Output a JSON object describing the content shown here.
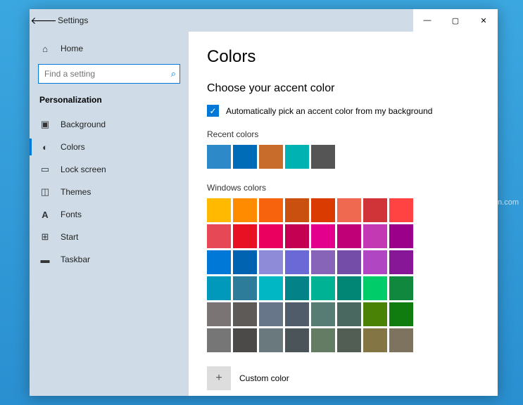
{
  "window": {
    "title": "Settings"
  },
  "sidebar": {
    "home": "Home",
    "search_placeholder": "Find a setting",
    "section": "Personalization",
    "items": [
      {
        "icon": "picture-icon",
        "label": "Background"
      },
      {
        "icon": "palette-icon",
        "label": "Colors"
      },
      {
        "icon": "lock-icon",
        "label": "Lock screen"
      },
      {
        "icon": "themes-icon",
        "label": "Themes"
      },
      {
        "icon": "fonts-icon",
        "label": "Fonts"
      },
      {
        "icon": "start-icon",
        "label": "Start"
      },
      {
        "icon": "taskbar-icon",
        "label": "Taskbar"
      }
    ]
  },
  "content": {
    "title": "Colors",
    "choose_heading": "Choose your accent color",
    "auto_checkbox_label": "Automatically pick an accent color from my background",
    "recent_heading": "Recent colors",
    "recent_colors": [
      "#2d89c8",
      "#006cb8",
      "#c86c2c",
      "#00b2b2",
      "#555555"
    ],
    "windows_heading": "Windows colors",
    "windows_colors": [
      "#ffb900",
      "#ff8c00",
      "#f7630c",
      "#ca5010",
      "#da3b01",
      "#ef6950",
      "#d13438",
      "#ff4343",
      "#e74856",
      "#e81123",
      "#ea005e",
      "#c30052",
      "#e3008c",
      "#bf0077",
      "#c239b3",
      "#9a0089",
      "#0078d7",
      "#0063b1",
      "#8e8cd8",
      "#6b69d6",
      "#8764b8",
      "#744da9",
      "#b146c2",
      "#881798",
      "#0099bc",
      "#2d7d9a",
      "#00b7c3",
      "#038387",
      "#00b294",
      "#018574",
      "#00cc6a",
      "#10893e",
      "#7a7574",
      "#5d5a58",
      "#68768a",
      "#515c6b",
      "#567c73",
      "#486860",
      "#498205",
      "#107c10",
      "#767676",
      "#4c4a48",
      "#69797e",
      "#4a5459",
      "#647c64",
      "#525e54",
      "#847545",
      "#7e735f"
    ],
    "custom_label": "Custom color"
  },
  "watermark": "wsxdn.com"
}
